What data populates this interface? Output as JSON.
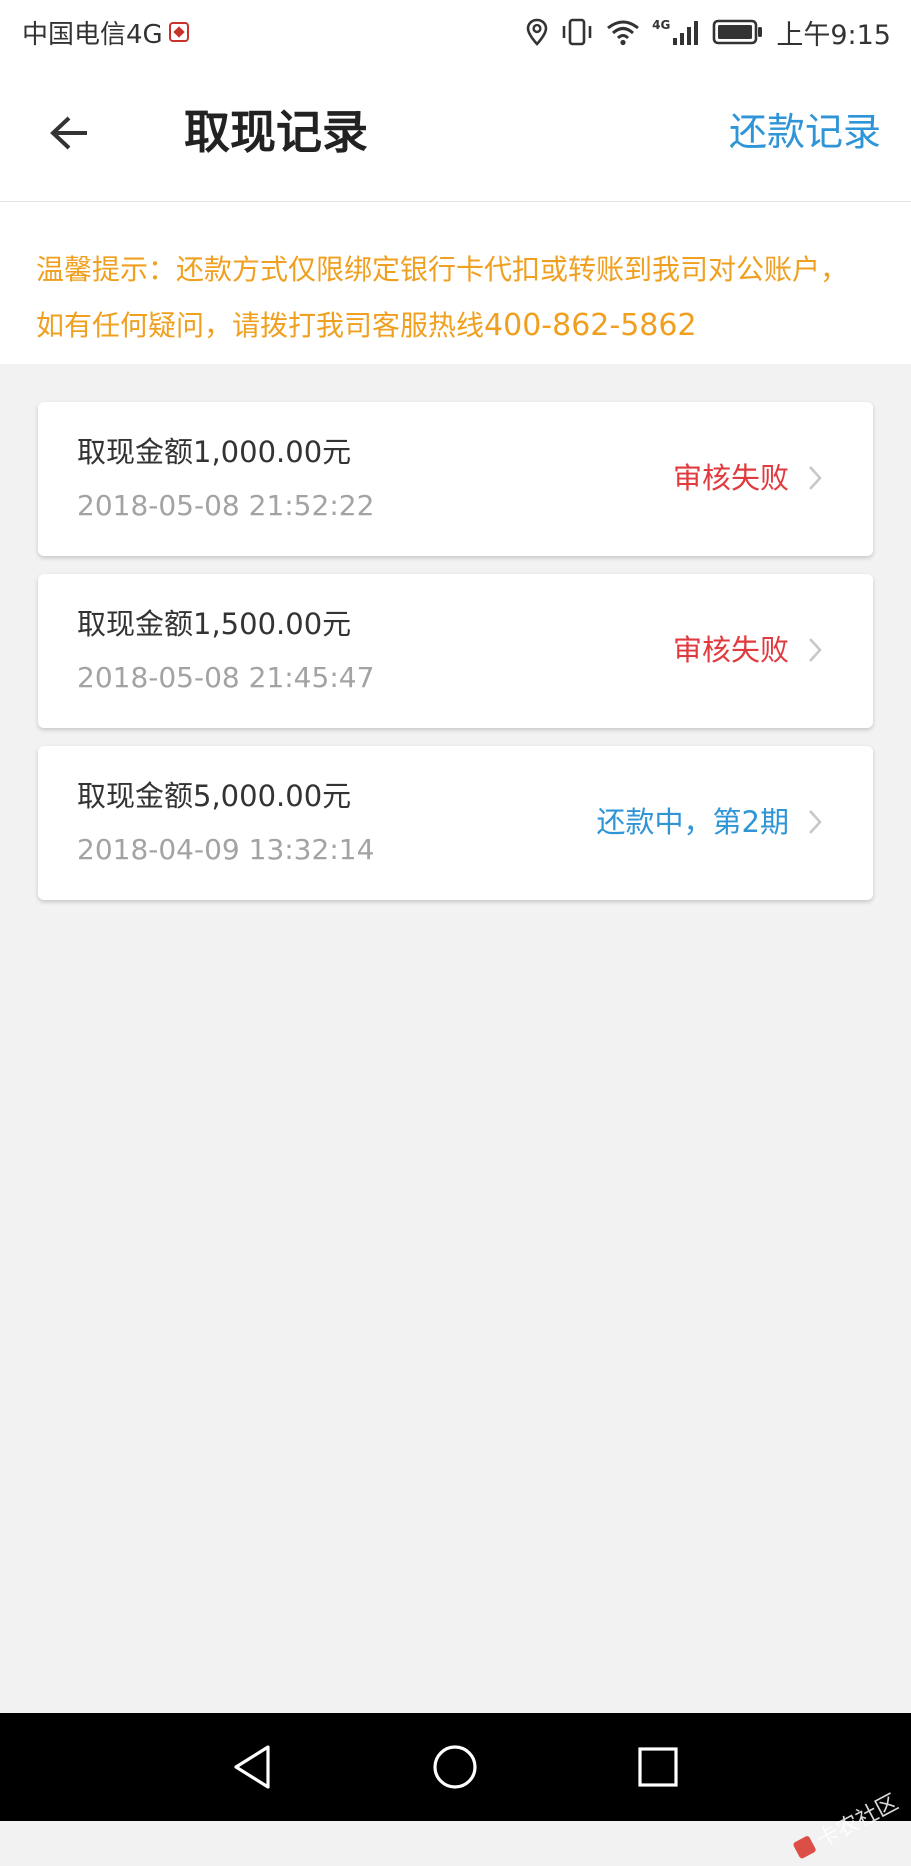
{
  "status_bar": {
    "carrier": "中国电信4G",
    "signal_label": "4G",
    "time": "上午9:15"
  },
  "header": {
    "title": "取现记录",
    "repay_records_label": "还款记录"
  },
  "notice": {
    "text": "温馨提示：还款方式仅限绑定银行卡代扣或转账到我司对公账户， 如有任何疑问，请拨打我司客服热线",
    "hotline": "400-862-5862"
  },
  "records": [
    {
      "amount": "取现金额1,000.00元",
      "time": "2018-05-08 21:52:22",
      "status": "审核失败",
      "status_color": "#e03a3e"
    },
    {
      "amount": "取现金额1,500.00元",
      "time": "2018-05-08 21:45:47",
      "status": "审核失败",
      "status_color": "#e03a3e"
    },
    {
      "amount": "取现金额5,000.00元",
      "time": "2018-04-09 13:32:14",
      "status": "还款中，第2期",
      "status_color": "#2f95d6"
    }
  ],
  "nav_bar": {
    "watermark": "卡农社区"
  },
  "colors": {
    "accent": "#2f95d6",
    "notice": "#f0a020",
    "failed": "#e03a3e"
  },
  "icons": {
    "back": "arrow-left-icon",
    "chevron": "chevron-right-icon",
    "location": "location-icon",
    "vibrate": "vibrate-icon",
    "wifi": "wifi-icon",
    "signal": "signal-icon",
    "battery": "battery-icon",
    "nav_back": "triangle-back-icon",
    "nav_home": "circle-home-icon",
    "nav_recents": "square-recents-icon"
  }
}
